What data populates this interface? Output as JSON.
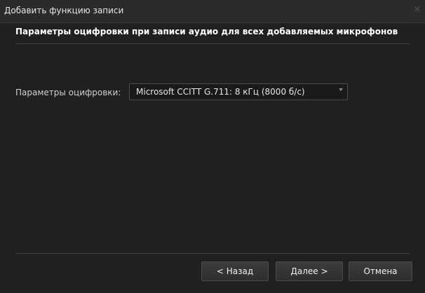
{
  "window": {
    "title": "Добавить функцию записи",
    "close_icon": "close-icon"
  },
  "section": {
    "heading": "Параметры оцифровки при записи аудио для всех добавляемых микрофонов"
  },
  "form": {
    "digitization_label": "Параметры оцифровки:",
    "digitization_value": "Microsoft CCITT G.711: 8 кГц (8000 б/с)"
  },
  "buttons": {
    "back": "< Назад",
    "next": "Далее >",
    "cancel": "Отмена"
  }
}
